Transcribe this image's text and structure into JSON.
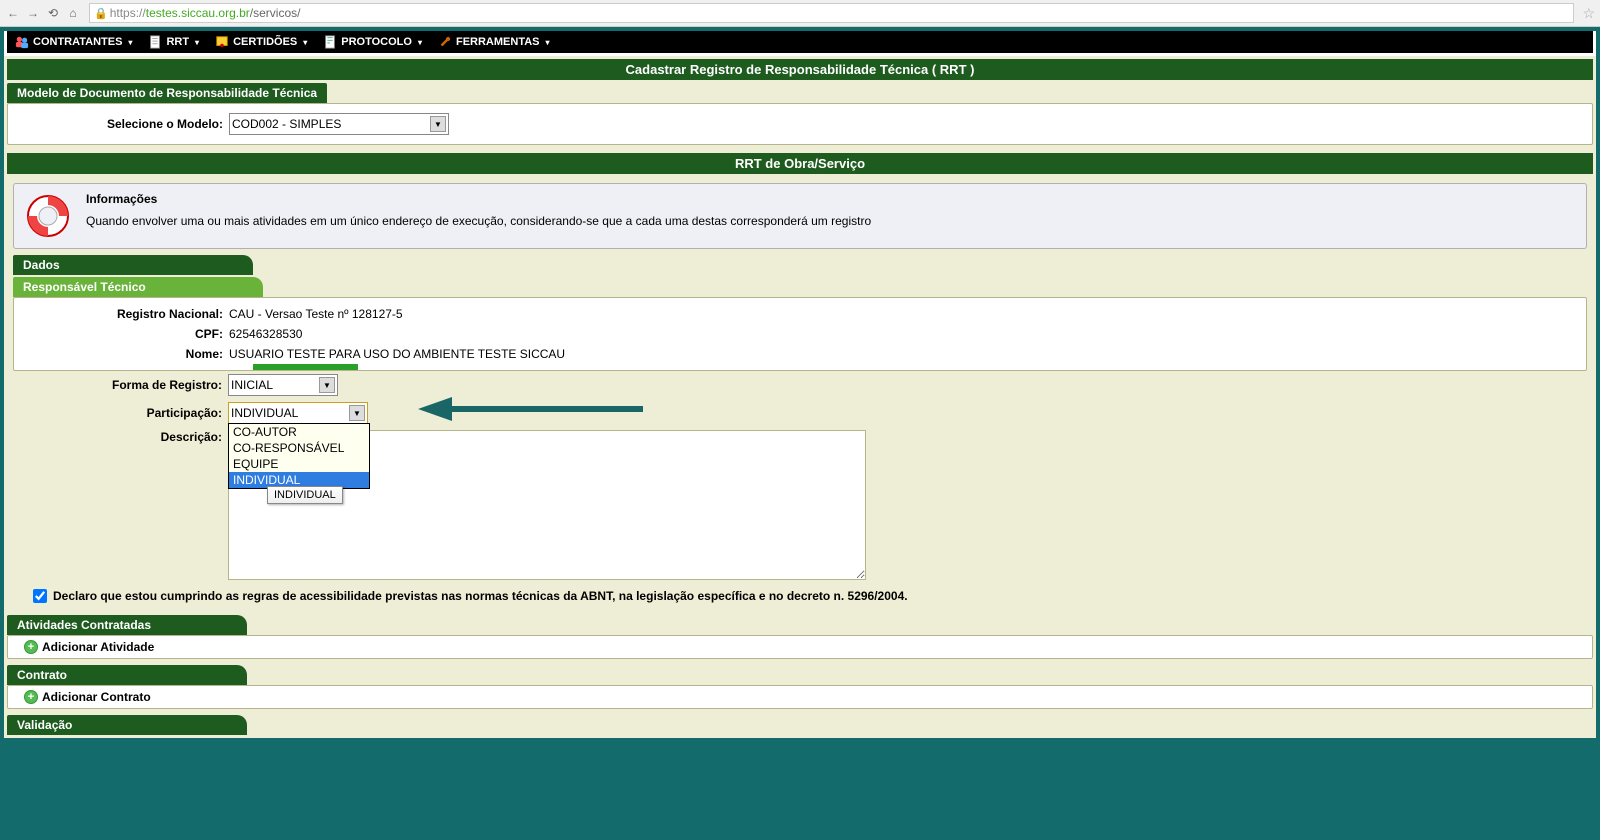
{
  "url": "https://testes.siccau.org.br/servicos/",
  "url_host": "testes.siccau.org.br",
  "url_path": "/servicos/",
  "nav": {
    "contratantes": "CONTRATANTES",
    "rrt": "RRT",
    "certidoes": "CERTIDÕES",
    "protocolo": "PROTOCOLO",
    "ferramentas": "FERRAMENTAS"
  },
  "page_title": "Cadastrar Registro de Responsabilidade Técnica ( RRT )",
  "modelo": {
    "legend": "Modelo de Documento de Responsabilidade Técnica",
    "label": "Selecione o Modelo:",
    "value": "COD002 - SIMPLES"
  },
  "obra": {
    "title": "RRT de Obra/Serviço",
    "info_heading": "Informações",
    "info_text": "Quando envolver uma ou mais atividades em um único endereço de execução, considerando-se que a cada uma destas corresponderá um registro"
  },
  "dados_tab": "Dados",
  "responsavel": {
    "legend": "Responsável Técnico",
    "registro_label": "Registro Nacional:",
    "registro_value": "CAU - Versao Teste nº 128127-5",
    "cpf_label": "CPF:",
    "cpf_value": "62546328530",
    "nome_label": "Nome:",
    "nome_value": "USUARIO TESTE PARA USO DO AMBIENTE TESTE SICCAU"
  },
  "forma_registro": {
    "label": "Forma de Registro:",
    "value": "INICIAL"
  },
  "participacao": {
    "label": "Participação:",
    "value": "INDIVIDUAL",
    "options": [
      "CO-AUTOR",
      "CO-RESPONSÁVEL",
      "EQUIPE",
      "INDIVIDUAL"
    ],
    "tooltip": "INDIVIDUAL"
  },
  "descricao_label": "Descrição:",
  "declaracao": "Declaro que estou cumprindo as regras de acessibilidade previstas nas normas técnicas da ABNT, na legislação específica e no decreto n. 5296/2004.",
  "atividades": {
    "legend": "Atividades Contratadas",
    "add": "Adicionar Atividade"
  },
  "contrato": {
    "legend": "Contrato",
    "add": "Adicionar Contrato"
  },
  "validacao": {
    "legend": "Validação"
  }
}
